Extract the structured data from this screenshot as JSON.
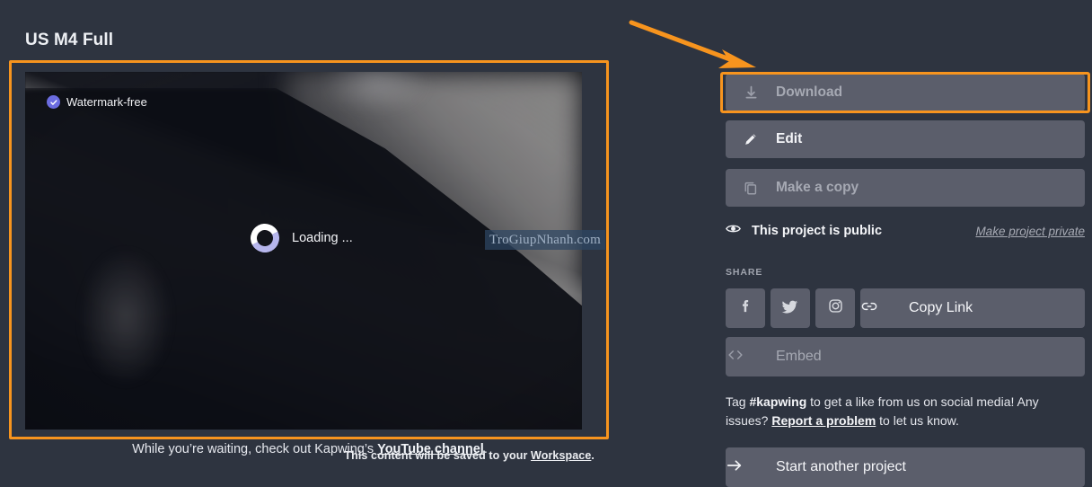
{
  "page": {
    "title": "US M4 Full",
    "background_color": "#2e3440",
    "accent_color": "#f7941e",
    "button_color": "#5b5e6b"
  },
  "player": {
    "watermark_badge": "Watermark-free",
    "badge_icon": "check-circle-icon",
    "loading_text": "Loading ...",
    "spinner_icon": "loading-spinner-icon",
    "site_watermark": "TroGiupNhanh.com",
    "footnote_prefix": "This content will be saved to your ",
    "footnote_link": "Workspace",
    "footnote_suffix": "."
  },
  "caption": {
    "prefix": "While you’re waiting, check out Kapwing’s ",
    "link": "YouTube channel",
    "suffix": "."
  },
  "annotation": {
    "arrow_icon": "orange-arrow-icon",
    "highlight_player": "orange-highlight-box",
    "highlight_download": "orange-highlight-box"
  },
  "actions": {
    "download": {
      "label": "Download",
      "icon": "download-icon",
      "state": "disabled"
    },
    "edit": {
      "label": "Edit",
      "icon": "pencil-icon",
      "state": "enabled"
    },
    "make_copy": {
      "label": "Make a copy",
      "icon": "copy-icon",
      "state": "disabled"
    }
  },
  "visibility": {
    "icon": "eye-icon",
    "status": "This project is public",
    "toggle_link": "Make project private"
  },
  "share": {
    "section_label": "SHARE",
    "facebook_icon": "facebook-icon",
    "twitter_icon": "twitter-icon",
    "instagram_icon": "instagram-icon",
    "copy_link": {
      "label": "Copy Link",
      "icon": "link-icon"
    },
    "embed": {
      "label": "Embed",
      "icon": "code-brackets-icon"
    }
  },
  "tag_note": {
    "part1": "Tag ",
    "hashtag": "#kapwing",
    "part2": " to get a like from us on social media! Any issues? ",
    "report_link": "Report a problem",
    "part3": " to let us know."
  },
  "footer": {
    "start_another": {
      "label": "Start another project",
      "icon": "arrow-right-icon"
    }
  }
}
